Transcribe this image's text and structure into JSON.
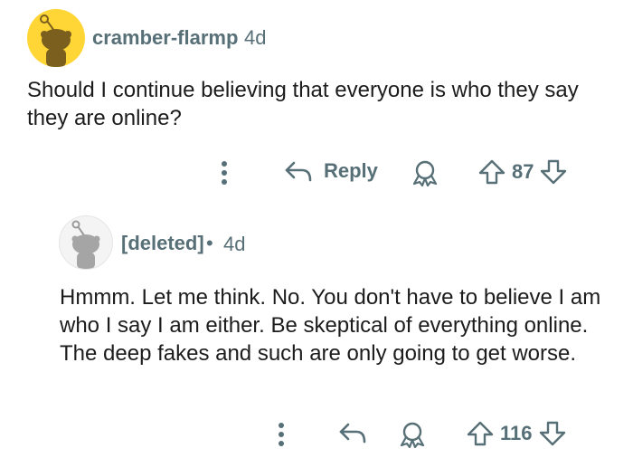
{
  "comment": {
    "username": "cramber-flarmp",
    "time": "4d",
    "body": "Should I continue believing that everyone is who they say they are online?",
    "reply_label": "Reply",
    "score": "87"
  },
  "reply": {
    "username": "[deleted]",
    "separator": "•",
    "time": "4d",
    "body": "Hmmm. Let me think. No. You don't have to believe I am who I say I am either. Be skeptical of everything online. The deep fakes and such are only going to get worse.",
    "score": "116"
  },
  "colors": {
    "avatar_yellow": "#ffd635",
    "meta_gray": "#576f76",
    "text": "#1c1c1c"
  }
}
